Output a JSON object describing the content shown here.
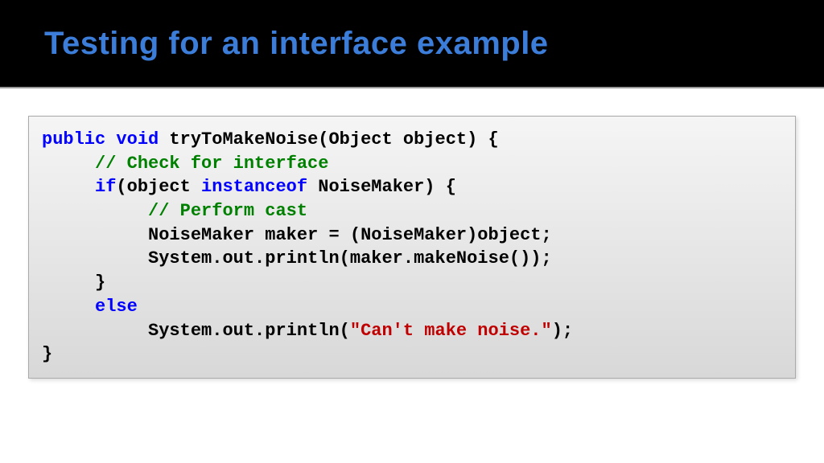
{
  "slide": {
    "title": "Testing for an interface example"
  },
  "code": {
    "l1_kw1": "public",
    "l1_kw2": "void",
    "l1_rest": " tryToMakeNoise(Object object) {",
    "l2_indent": "     ",
    "l2_comment": "// Check for interface",
    "l3_indent": "     ",
    "l3_kw1": "if",
    "l3_mid1": "(object ",
    "l3_kw2": "instanceof",
    "l3_rest": " NoiseMaker) {",
    "l4_indent": "          ",
    "l4_comment": "// Perform cast",
    "l5_indent": "          ",
    "l5_text": "NoiseMaker maker = (NoiseMaker)object;",
    "l6_indent": "          ",
    "l6_text": "System.out.println(maker.makeNoise());",
    "l7_indent": "     ",
    "l7_text": "}",
    "l8_indent": "     ",
    "l8_kw": "else",
    "l9_indent": "          ",
    "l9_text1": "System.out.println(",
    "l9_str": "\"Can't make noise.\"",
    "l9_text2": ");",
    "l10_text": "}"
  }
}
